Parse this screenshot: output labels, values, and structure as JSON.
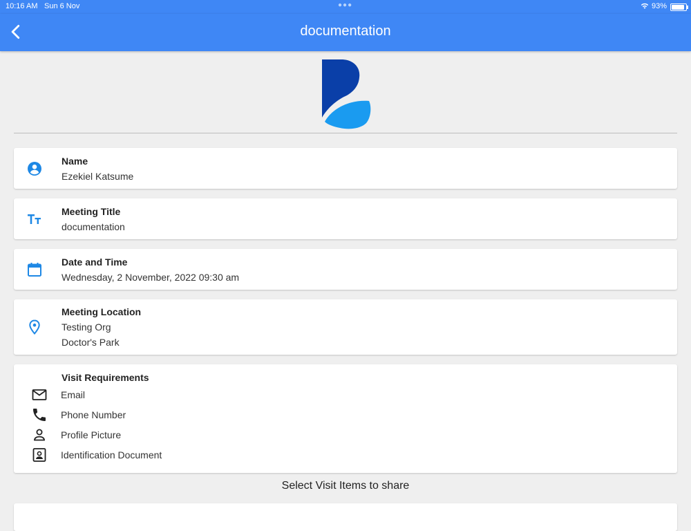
{
  "status_bar": {
    "time": "10:16 AM",
    "date": "Sun 6 Nov",
    "battery": "93%"
  },
  "header": {
    "title": "documentation",
    "back_icon": "chevron-left-icon"
  },
  "colors": {
    "primary": "#3f87f5",
    "icon_blue": "#1e88e5",
    "logo_dark": "#0a3fa8",
    "logo_light": "#1a9bf0"
  },
  "details": {
    "name": {
      "label": "Name",
      "value": "Ezekiel Katsume",
      "icon": "account-circle-icon"
    },
    "meeting_title": {
      "label": "Meeting Title",
      "value": "documentation",
      "icon": "text-size-icon"
    },
    "date_time": {
      "label": "Date and Time",
      "value": "Wednesday, 2 November, 2022 09:30 am",
      "icon": "calendar-icon"
    },
    "location": {
      "label": "Meeting Location",
      "line1": "Testing Org",
      "line2": "Doctor's Park",
      "icon": "location-pin-icon"
    }
  },
  "visit_requirements": {
    "label": "Visit Requirements",
    "items": [
      {
        "text": "Email",
        "icon": "mail-icon"
      },
      {
        "text": "Phone Number",
        "icon": "phone-icon"
      },
      {
        "text": "Profile Picture",
        "icon": "person-icon"
      },
      {
        "text": "Identification Document",
        "icon": "id-card-icon"
      }
    ]
  },
  "share_label": "Select Visit Items to share"
}
